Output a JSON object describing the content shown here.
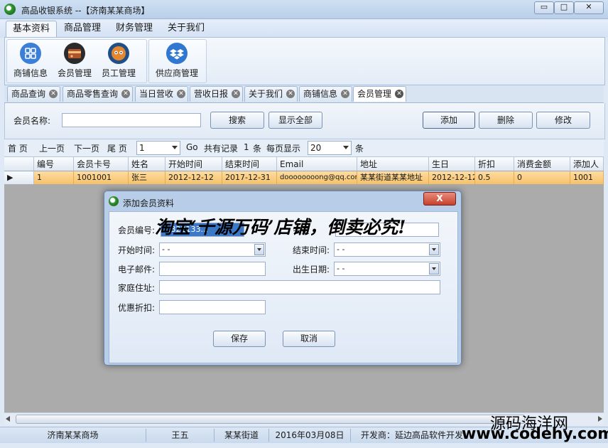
{
  "window": {
    "title": "高品收银系统 --【济南某某商场】",
    "min_label": "▭",
    "max_label": "□",
    "close_label": "✕"
  },
  "menu": {
    "tabs": [
      "基本资料",
      "商品管理",
      "财务管理",
      "关于我们"
    ]
  },
  "ribbon": {
    "buttons": [
      {
        "label": "商铺信息",
        "icon": "grid-icon",
        "color": "#3b7fd9"
      },
      {
        "label": "会员管理",
        "icon": "member-card-icon",
        "color": "#b0532a"
      },
      {
        "label": "员工管理",
        "icon": "staff-face-icon",
        "color": "#e4862e"
      },
      {
        "label": "供应商管理",
        "icon": "dropbox-icon",
        "color": "#2f77d0"
      }
    ]
  },
  "doc_tabs": [
    "商品查询",
    "商品零售查询",
    "当日营收",
    "营收日报",
    "关于我们",
    "商铺信息",
    "会员管理"
  ],
  "search": {
    "label": "会员名称:",
    "value": "",
    "search_btn": "搜索",
    "show_all_btn": "显示全部",
    "add_btn": "添加",
    "delete_btn": "删除",
    "edit_btn": "修改"
  },
  "pager": {
    "first": "首 页",
    "prev": "上一页",
    "next": "下一页",
    "last": "尾 页",
    "page": "1",
    "go": "Go",
    "total_prefix": "共有记录",
    "total": "1",
    "total_unit": "条",
    "per_page_label": "每页显示",
    "per_page": "20",
    "per_page_unit": "条"
  },
  "table": {
    "columns": [
      "编号",
      "会员卡号",
      "姓名",
      "开始时间",
      "结束时间",
      "Email",
      "地址",
      "生日",
      "折扣",
      "消费金额",
      "添加人"
    ],
    "rows": [
      [
        "1",
        "1001001",
        "张三",
        "2012-12-12",
        "2017-12-31",
        "doooooooong@qq.com",
        "某某街道某某地址",
        "2012-12-12",
        "0.5",
        "0",
        "1001"
      ]
    ]
  },
  "dialog": {
    "title": "添加会员资料",
    "close_label": "X",
    "member_no_label": "会员编号:",
    "member_no_value": "...322133...",
    "card_label": "会员",
    "start_label": "开始时间:",
    "start_value": "  -   -",
    "end_label": "结束时间:",
    "end_value": "  -   -",
    "email_label": "电子邮件:",
    "email_value": "",
    "birthday_label": "出生日期:",
    "birthday_value": "  -   -",
    "address_label": "家庭住址:",
    "address_value": "",
    "discount_label": "优惠折扣:",
    "discount_value": "",
    "save_btn": "保存",
    "cancel_btn": "取消"
  },
  "watermark": "淘宝‘千源万码’店铺，倒卖必究!",
  "status": {
    "store": "济南某某商场",
    "user": "王五",
    "address": "某某街道",
    "date": "2016年03月08日",
    "developer": "开发商：延边高品软件开发"
  },
  "brand": {
    "name": "源码海洋网",
    "url": "www.codehy.com"
  }
}
